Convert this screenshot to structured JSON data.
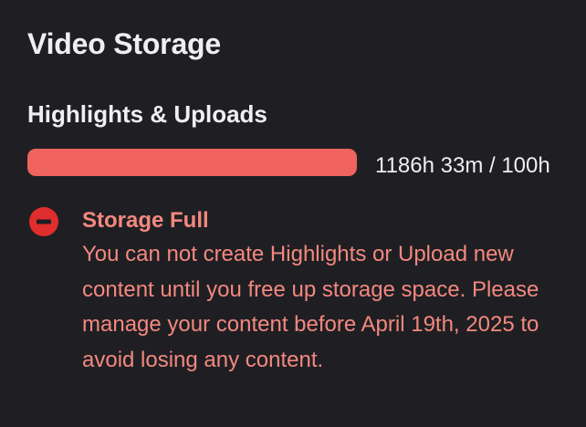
{
  "page": {
    "title": "Video Storage"
  },
  "storage": {
    "section_title": "Highlights & Uploads",
    "usage_text": "1186h 33m / 100h",
    "used_fraction": 1.0,
    "bar_color": "#f0635e",
    "track_color": "#3a3a3f"
  },
  "alert": {
    "icon": "minus-circle-icon",
    "icon_color": "#e02d2d",
    "text_color": "#f3887f",
    "title": "Storage Full",
    "message": "You can not create Highlights or Upload new content until you free up storage space. Please manage your content before April 19th, 2025 to avoid losing any content."
  }
}
